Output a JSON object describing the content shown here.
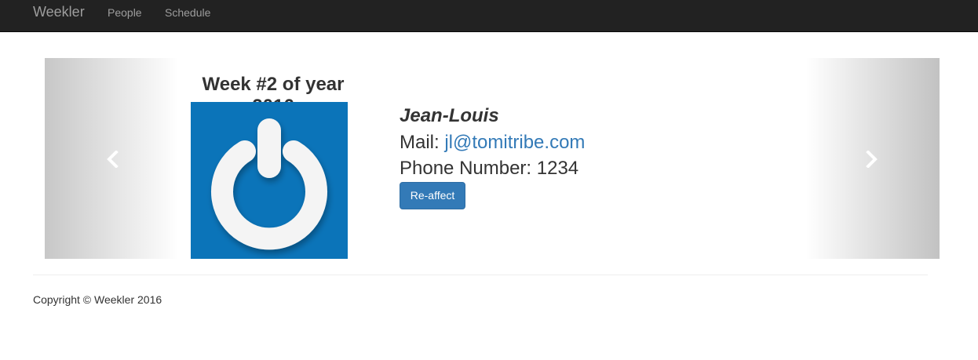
{
  "navbar": {
    "brand": "Weekler",
    "links": [
      {
        "label": "People"
      },
      {
        "label": "Schedule"
      }
    ],
    "background": "#222222"
  },
  "carousel": {
    "week_title": "Week #2 of year 2016",
    "avatar_icon": "gravatar-power-icon",
    "avatar_color": "#0b74b9",
    "person": {
      "name": "Jean-Louis",
      "mail_label": "Mail: ",
      "mail": "jl@tomitribe.com",
      "phone_label": "Phone Number: ",
      "phone": "1234"
    },
    "action_label": "Re-affect",
    "prev_icon": "chevron-left-icon",
    "next_icon": "chevron-right-icon"
  },
  "footer": {
    "copyright": "Copyright © Weekler 2016"
  },
  "colors": {
    "link": "#337ab7",
    "button": "#337ab7"
  }
}
